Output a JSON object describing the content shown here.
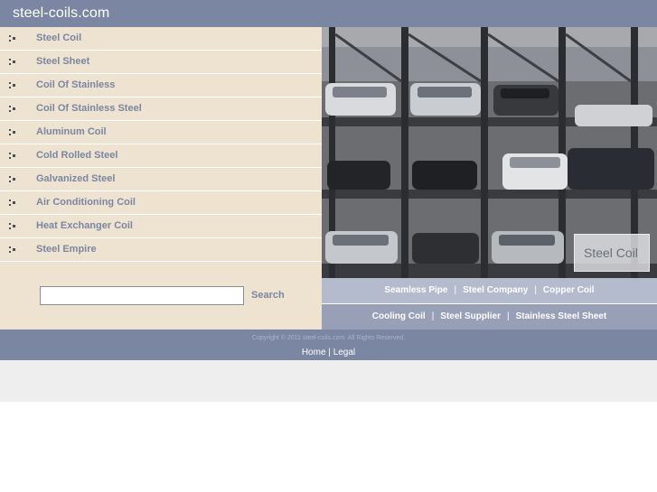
{
  "header": {
    "site_title": "steel-coils.com"
  },
  "sidebar": {
    "items": [
      {
        "label": "Steel Coil"
      },
      {
        "label": "Steel Sheet"
      },
      {
        "label": "Coil Of Stainless"
      },
      {
        "label": "Coil Of Stainless Steel"
      },
      {
        "label": "Aluminum Coil"
      },
      {
        "label": "Cold Rolled Steel"
      },
      {
        "label": "Galvanized Steel"
      },
      {
        "label": "Air Conditioning Coil"
      },
      {
        "label": "Heat Exchanger Coil"
      },
      {
        "label": "Steel Empire"
      }
    ],
    "search": {
      "value": "",
      "placeholder": "",
      "button_label": "Search"
    }
  },
  "photo": {
    "caption": "Steel Coil"
  },
  "links": {
    "row1": [
      "Seamless Pipe",
      "Steel Company",
      "Copper Coil"
    ],
    "row2": [
      "Cooling Coil",
      "Steel Supplier",
      "Stainless Steel Sheet"
    ],
    "separator": "|"
  },
  "footer": {
    "copyright": "Copyright © 2011 steel-coils.com. All Rights Reserved.",
    "home": "Home",
    "separator": "|",
    "legal": "Legal"
  },
  "colors": {
    "header_bg": "#7a86a2",
    "sidebar_bg": "#eee3d0",
    "link_text": "#7a86a2",
    "linkbar_light": "#b4bbcd",
    "linkbar_dark": "#98a0b7"
  }
}
